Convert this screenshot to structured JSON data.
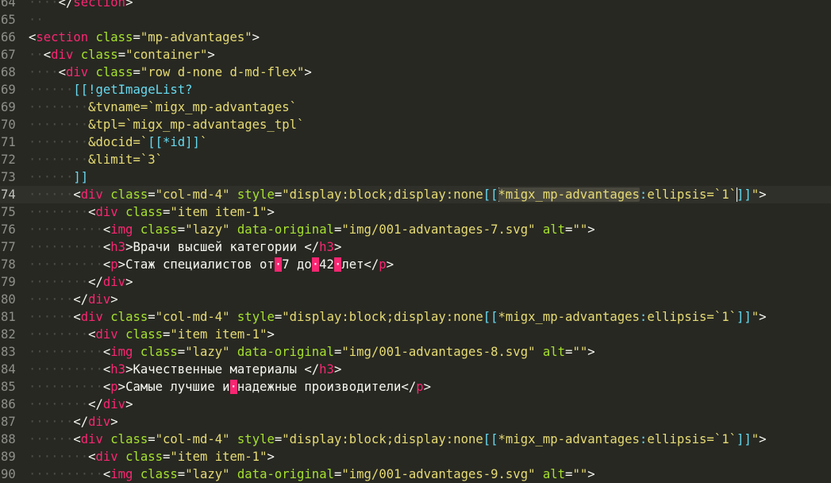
{
  "colors": {
    "background": "#272822",
    "tag": "#f92672",
    "attribute": "#a6e22e",
    "string": "#e6db74",
    "modx": "#66d9ef",
    "text": "#f8f8f2",
    "gutter": "#8f908a"
  },
  "lines": [
    {
      "num": "64",
      "tokens": [
        [
          "ind",
          "····"
        ],
        [
          "pun",
          "</"
        ],
        [
          "tag",
          "section"
        ],
        [
          "pun",
          ">"
        ]
      ]
    },
    {
      "num": "65",
      "tokens": [
        [
          "ind",
          "··"
        ]
      ]
    },
    {
      "num": "66",
      "tokens": [
        [
          "pun",
          "<"
        ],
        [
          "tag",
          "section"
        ],
        [
          "txt",
          " "
        ],
        [
          "atr",
          "class"
        ],
        [
          "pun",
          "="
        ],
        [
          "str",
          "\"mp-advantages\""
        ],
        [
          "pun",
          ">"
        ]
      ]
    },
    {
      "num": "67",
      "tokens": [
        [
          "ind",
          "··"
        ],
        [
          "pun",
          "<"
        ],
        [
          "tag",
          "div"
        ],
        [
          "txt",
          " "
        ],
        [
          "atr",
          "class"
        ],
        [
          "pun",
          "="
        ],
        [
          "str",
          "\"container\""
        ],
        [
          "pun",
          ">"
        ]
      ]
    },
    {
      "num": "68",
      "tokens": [
        [
          "ind",
          "····"
        ],
        [
          "pun",
          "<"
        ],
        [
          "tag",
          "div"
        ],
        [
          "txt",
          " "
        ],
        [
          "atr",
          "class"
        ],
        [
          "pun",
          "="
        ],
        [
          "str",
          "\"row d-none d-md-flex\""
        ],
        [
          "pun",
          ">"
        ]
      ]
    },
    {
      "num": "69",
      "tokens": [
        [
          "ind",
          "······"
        ],
        [
          "mod",
          "[[!getImageList?"
        ]
      ]
    },
    {
      "num": "69",
      "tokens": [
        [
          "ind",
          "········"
        ],
        [
          "str",
          "&tvname=`migx_mp-advantages`"
        ]
      ]
    },
    {
      "num": "70",
      "tokens": [
        [
          "ind",
          "········"
        ],
        [
          "str",
          "&tpl=`migx_mp-advantages_tpl`"
        ]
      ]
    },
    {
      "num": "71",
      "tokens": [
        [
          "ind",
          "········"
        ],
        [
          "str",
          "&docid=`"
        ],
        [
          "mod",
          "[[*id]]"
        ],
        [
          "str",
          "`"
        ]
      ]
    },
    {
      "num": "72",
      "tokens": [
        [
          "ind",
          "········"
        ],
        [
          "str",
          "&limit=`3`"
        ]
      ]
    },
    {
      "num": "73",
      "tokens": [
        [
          "ind",
          "······"
        ],
        [
          "mod",
          "]]"
        ]
      ]
    },
    {
      "num": "74",
      "active": true,
      "tokens": [
        [
          "ind",
          "······"
        ],
        [
          "pun",
          "<"
        ],
        [
          "tag",
          "div"
        ],
        [
          "txt",
          " "
        ],
        [
          "atr",
          "class"
        ],
        [
          "pun",
          "="
        ],
        [
          "str",
          "\"col-md-4\""
        ],
        [
          "txt",
          " "
        ],
        [
          "atr",
          "style"
        ],
        [
          "pun",
          "="
        ],
        [
          "str",
          "\"display:block;display:none"
        ],
        [
          "mod",
          "[["
        ],
        [
          "caret",
          ""
        ],
        [
          "hlw",
          "*migx_mp-advantages"
        ],
        [
          "mod",
          ":"
        ],
        [
          "str",
          "ellipsis=`1`"
        ],
        [
          "caret",
          ""
        ],
        [
          "mod",
          "]]"
        ],
        [
          "str",
          "\""
        ],
        [
          "pun",
          ">"
        ]
      ]
    },
    {
      "num": "75",
      "tokens": [
        [
          "ind",
          "········"
        ],
        [
          "pun",
          "<"
        ],
        [
          "tag",
          "div"
        ],
        [
          "txt",
          " "
        ],
        [
          "atr",
          "class"
        ],
        [
          "pun",
          "="
        ],
        [
          "str",
          "\"item item-1\""
        ],
        [
          "pun",
          ">"
        ]
      ]
    },
    {
      "num": "76",
      "tokens": [
        [
          "ind",
          "··········"
        ],
        [
          "pun",
          "<"
        ],
        [
          "tag",
          "img"
        ],
        [
          "txt",
          " "
        ],
        [
          "atr",
          "class"
        ],
        [
          "pun",
          "="
        ],
        [
          "str",
          "\"lazy\""
        ],
        [
          "txt",
          " "
        ],
        [
          "atr",
          "data-original"
        ],
        [
          "pun",
          "="
        ],
        [
          "str",
          "\"img/001-advantages-7.svg\""
        ],
        [
          "txt",
          " "
        ],
        [
          "atr",
          "alt"
        ],
        [
          "pun",
          "="
        ],
        [
          "str",
          "\"\""
        ],
        [
          "pun",
          ">"
        ]
      ]
    },
    {
      "num": "77",
      "tokens": [
        [
          "ind",
          "··········"
        ],
        [
          "pun",
          "<"
        ],
        [
          "tag",
          "h3"
        ],
        [
          "pun",
          ">"
        ],
        [
          "txt",
          "Врачи высшей категории "
        ],
        [
          "pun",
          "</"
        ],
        [
          "tag",
          "h3"
        ],
        [
          "pun",
          ">"
        ]
      ]
    },
    {
      "num": "78",
      "tokens": [
        [
          "ind",
          "··········"
        ],
        [
          "pun",
          "<"
        ],
        [
          "tag",
          "p"
        ],
        [
          "pun",
          ">"
        ],
        [
          "txt",
          "Стаж специалистов от"
        ],
        [
          "ws",
          "·"
        ],
        [
          "txt",
          "7 до"
        ],
        [
          "ws",
          "·"
        ],
        [
          "txt",
          "42"
        ],
        [
          "ws",
          "·"
        ],
        [
          "txt",
          "лет"
        ],
        [
          "pun",
          "</"
        ],
        [
          "tag",
          "p"
        ],
        [
          "pun",
          ">"
        ]
      ]
    },
    {
      "num": "79",
      "tokens": [
        [
          "ind",
          "········"
        ],
        [
          "pun",
          "</"
        ],
        [
          "tag",
          "div"
        ],
        [
          "pun",
          ">"
        ]
      ]
    },
    {
      "num": "80",
      "tokens": [
        [
          "ind",
          "······"
        ],
        [
          "pun",
          "</"
        ],
        [
          "tag",
          "div"
        ],
        [
          "pun",
          ">"
        ]
      ]
    },
    {
      "num": "81",
      "tokens": [
        [
          "ind",
          "······"
        ],
        [
          "pun",
          "<"
        ],
        [
          "tag",
          "div"
        ],
        [
          "txt",
          " "
        ],
        [
          "atr",
          "class"
        ],
        [
          "pun",
          "="
        ],
        [
          "str",
          "\"col-md-4\""
        ],
        [
          "txt",
          " "
        ],
        [
          "atr",
          "style"
        ],
        [
          "pun",
          "="
        ],
        [
          "str",
          "\"display:block;display:none"
        ],
        [
          "mod",
          "[["
        ],
        [
          "str",
          "*migx_mp-advantages"
        ],
        [
          "mod",
          ":"
        ],
        [
          "str",
          "ellipsis=`1`"
        ],
        [
          "mod",
          "]]"
        ],
        [
          "str",
          "\""
        ],
        [
          "pun",
          ">"
        ]
      ]
    },
    {
      "num": "82",
      "tokens": [
        [
          "ind",
          "········"
        ],
        [
          "pun",
          "<"
        ],
        [
          "tag",
          "div"
        ],
        [
          "txt",
          " "
        ],
        [
          "atr",
          "class"
        ],
        [
          "pun",
          "="
        ],
        [
          "str",
          "\"item item-1\""
        ],
        [
          "pun",
          ">"
        ]
      ]
    },
    {
      "num": "83",
      "tokens": [
        [
          "ind",
          "··········"
        ],
        [
          "pun",
          "<"
        ],
        [
          "tag",
          "img"
        ],
        [
          "txt",
          " "
        ],
        [
          "atr",
          "class"
        ],
        [
          "pun",
          "="
        ],
        [
          "str",
          "\"lazy\""
        ],
        [
          "txt",
          " "
        ],
        [
          "atr",
          "data-original"
        ],
        [
          "pun",
          "="
        ],
        [
          "str",
          "\"img/001-advantages-8.svg\""
        ],
        [
          "txt",
          " "
        ],
        [
          "atr",
          "alt"
        ],
        [
          "pun",
          "="
        ],
        [
          "str",
          "\"\""
        ],
        [
          "pun",
          ">"
        ]
      ]
    },
    {
      "num": "84",
      "tokens": [
        [
          "ind",
          "··········"
        ],
        [
          "pun",
          "<"
        ],
        [
          "tag",
          "h3"
        ],
        [
          "pun",
          ">"
        ],
        [
          "txt",
          "Качественные материалы "
        ],
        [
          "pun",
          "</"
        ],
        [
          "tag",
          "h3"
        ],
        [
          "pun",
          ">"
        ]
      ]
    },
    {
      "num": "85",
      "tokens": [
        [
          "ind",
          "··········"
        ],
        [
          "pun",
          "<"
        ],
        [
          "tag",
          "p"
        ],
        [
          "pun",
          ">"
        ],
        [
          "txt",
          "Самые лучшие и"
        ],
        [
          "ws",
          "·"
        ],
        [
          "txt",
          "надежные производители"
        ],
        [
          "pun",
          "</"
        ],
        [
          "tag",
          "p"
        ],
        [
          "pun",
          ">"
        ]
      ]
    },
    {
      "num": "86",
      "tokens": [
        [
          "ind",
          "········"
        ],
        [
          "pun",
          "</"
        ],
        [
          "tag",
          "div"
        ],
        [
          "pun",
          ">"
        ]
      ]
    },
    {
      "num": "87",
      "tokens": [
        [
          "ind",
          "······"
        ],
        [
          "pun",
          "</"
        ],
        [
          "tag",
          "div"
        ],
        [
          "pun",
          ">"
        ]
      ]
    },
    {
      "num": "88",
      "tokens": [
        [
          "ind",
          "······"
        ],
        [
          "pun",
          "<"
        ],
        [
          "tag",
          "div"
        ],
        [
          "txt",
          " "
        ],
        [
          "atr",
          "class"
        ],
        [
          "pun",
          "="
        ],
        [
          "str",
          "\"col-md-4\""
        ],
        [
          "txt",
          " "
        ],
        [
          "atr",
          "style"
        ],
        [
          "pun",
          "="
        ],
        [
          "str",
          "\"display:block;display:none"
        ],
        [
          "mod",
          "[["
        ],
        [
          "str",
          "*migx_mp-advantages"
        ],
        [
          "mod",
          ":"
        ],
        [
          "str",
          "ellipsis=`1`"
        ],
        [
          "mod",
          "]]"
        ],
        [
          "str",
          "\""
        ],
        [
          "pun",
          ">"
        ]
      ]
    },
    {
      "num": "89",
      "tokens": [
        [
          "ind",
          "········"
        ],
        [
          "pun",
          "<"
        ],
        [
          "tag",
          "div"
        ],
        [
          "txt",
          " "
        ],
        [
          "atr",
          "class"
        ],
        [
          "pun",
          "="
        ],
        [
          "str",
          "\"item item-1\""
        ],
        [
          "pun",
          ">"
        ]
      ]
    },
    {
      "num": "90",
      "tokens": [
        [
          "ind",
          "··········"
        ],
        [
          "pun",
          "<"
        ],
        [
          "tag",
          "img"
        ],
        [
          "txt",
          " "
        ],
        [
          "atr",
          "class"
        ],
        [
          "pun",
          "="
        ],
        [
          "str",
          "\"lazy\""
        ],
        [
          "txt",
          " "
        ],
        [
          "atr",
          "data-original"
        ],
        [
          "pun",
          "="
        ],
        [
          "str",
          "\"img/001-advantages-9.svg\""
        ],
        [
          "txt",
          " "
        ],
        [
          "atr",
          "alt"
        ],
        [
          "pun",
          "="
        ],
        [
          "str",
          "\"\""
        ],
        [
          "pun",
          ">"
        ]
      ]
    }
  ]
}
